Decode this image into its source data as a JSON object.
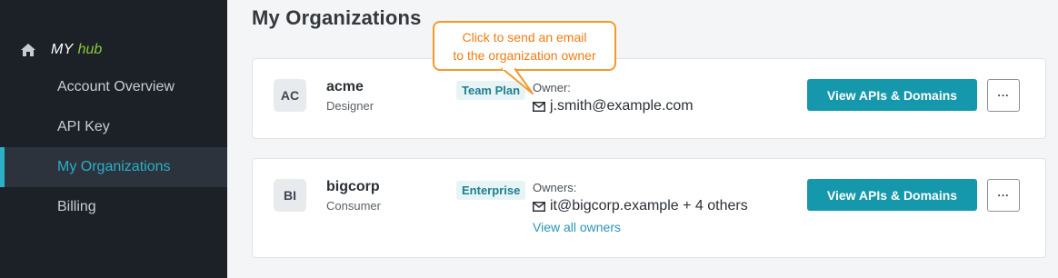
{
  "sidebar": {
    "brand": {
      "my": "MY",
      "hub": "hub"
    },
    "items": [
      {
        "label": "Account Overview",
        "active": false
      },
      {
        "label": "API Key",
        "active": false
      },
      {
        "label": "My Organizations",
        "active": true
      },
      {
        "label": "Billing",
        "active": false
      }
    ]
  },
  "main": {
    "title": "My Organizations",
    "tooltip": {
      "line1": "Click to send an email",
      "line2": "to the organization owner"
    },
    "orgs": [
      {
        "initials": "AC",
        "name": "acme",
        "role": "Designer",
        "plan": "Team Plan",
        "owner_label": "Owner:",
        "owner_email": "j.smith@example.com",
        "view_button": "View APIs & Domains",
        "more_button": "..."
      },
      {
        "initials": "BI",
        "name": "bigcorp",
        "role": "Consumer",
        "plan": "Enterprise",
        "owner_label": "Owners:",
        "owner_email": "it@bigcorp.example + 4 others",
        "view_all": "View all owners",
        "view_button": "View APIs & Domains",
        "more_button": "..."
      }
    ]
  },
  "colors": {
    "sidebar_bg": "#1c2127",
    "accent": "#2ab0c7",
    "brand_hub": "#8dc63f",
    "button": "#1597ac",
    "tooltip_border": "#f39a2b",
    "tooltip_text": "#ee7d12"
  },
  "icons": [
    "home-icon",
    "mail-icon",
    "more-icon"
  ]
}
